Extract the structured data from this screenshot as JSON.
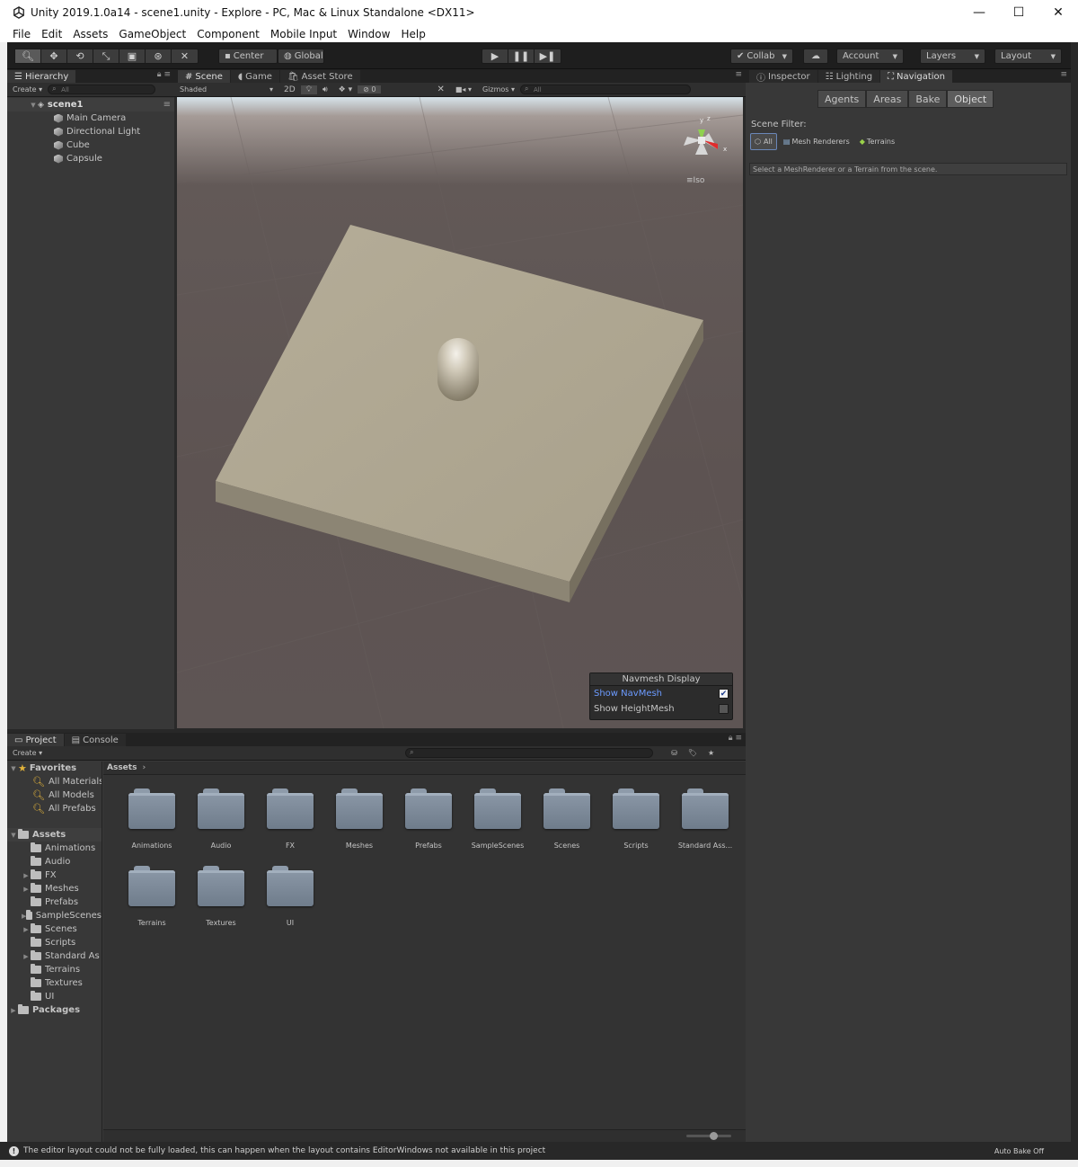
{
  "window": {
    "title": "Unity 2019.1.0a14 - scene1.unity - Explore - PC, Mac & Linux Standalone <DX11>",
    "minimize": "—",
    "maximize": "☐",
    "close": "✕"
  },
  "menu": [
    "File",
    "Edit",
    "Assets",
    "GameObject",
    "Component",
    "Mobile Input",
    "Window",
    "Help"
  ],
  "toolbar": {
    "center_label": "Center",
    "global_label": "Global",
    "collab_label": "Collab",
    "account_label": "Account",
    "layers_label": "Layers",
    "layout_label": "Layout"
  },
  "hierarchy": {
    "tab": "Hierarchy",
    "create": "Create",
    "search_placeholder": "All",
    "scene": "scene1",
    "items": [
      "Main Camera",
      "Directional Light",
      "Cube",
      "Capsule"
    ]
  },
  "scene_tabs": {
    "scene": "Scene",
    "game": "Game",
    "asset_store": "Asset Store",
    "shaded": "Shaded",
    "mode_2d": "2D",
    "hidden_count": "0",
    "gizmos": "Gizmos",
    "search_placeholder": "All",
    "gizmo_y": "y",
    "gizmo_z": "z",
    "gizmo_x": "x",
    "iso": "Iso"
  },
  "navmesh_display": {
    "title": "Navmesh Display",
    "show_navmesh": "Show NavMesh",
    "show_navmesh_checked": true,
    "show_heightmesh": "Show HeightMesh",
    "show_heightmesh_checked": false
  },
  "inspector": {
    "tabs": [
      "Inspector",
      "Lighting",
      "Navigation"
    ],
    "nav_tabs": [
      "Agents",
      "Areas",
      "Bake",
      "Object"
    ],
    "active_nav_tab": "Object",
    "scene_filter_label": "Scene Filter:",
    "filter_all": "All",
    "filter_mesh": "Mesh Renderers",
    "filter_terrains": "Terrains",
    "hint": "Select a MeshRenderer or a Terrain from the scene."
  },
  "project": {
    "tabs": [
      "Project",
      "Console"
    ],
    "create": "Create",
    "favorites_label": "Favorites",
    "favorites": [
      "All Materials",
      "All Models",
      "All Prefabs"
    ],
    "assets_label": "Assets",
    "asset_tree": [
      {
        "name": "Animations",
        "expandable": false
      },
      {
        "name": "Audio",
        "expandable": false
      },
      {
        "name": "FX",
        "expandable": true
      },
      {
        "name": "Meshes",
        "expandable": true
      },
      {
        "name": "Prefabs",
        "expandable": false
      },
      {
        "name": "SampleScenes",
        "expandable": true
      },
      {
        "name": "Scenes",
        "expandable": true
      },
      {
        "name": "Scripts",
        "expandable": false
      },
      {
        "name": "Standard As",
        "expandable": true
      },
      {
        "name": "Terrains",
        "expandable": false
      },
      {
        "name": "Textures",
        "expandable": false
      },
      {
        "name": "UI",
        "expandable": false
      }
    ],
    "packages_label": "Packages",
    "breadcrumb": "Assets",
    "grid": [
      "Animations",
      "Audio",
      "FX",
      "Meshes",
      "Prefabs",
      "SampleScenes",
      "Scenes",
      "Scripts",
      "Standard Ass...",
      "Terrains",
      "Textures",
      "UI"
    ]
  },
  "status": {
    "message": "The editor layout could not be fully loaded, this can happen when the layout contains EditorWindows not available in this project",
    "auto_bake": "Auto Bake Off"
  }
}
